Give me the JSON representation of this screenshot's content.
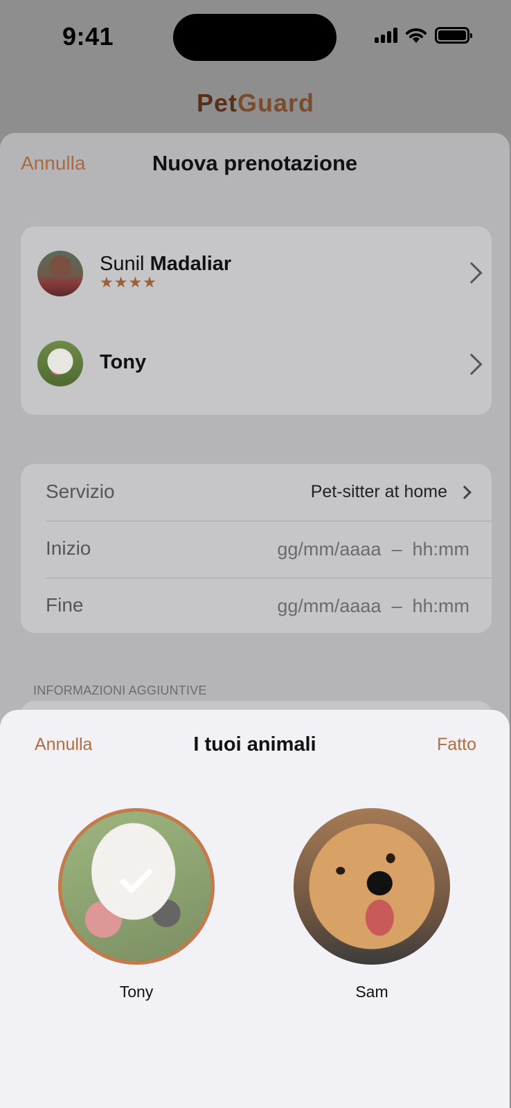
{
  "status_bar": {
    "time": "9:41"
  },
  "brand": {
    "part1": "Pet",
    "part2": "Guard"
  },
  "booking_sheet": {
    "cancel_label": "Annulla",
    "title": "Nuova prenotazione",
    "sitter": {
      "first_name": "Sunil",
      "last_name": "Madaliar",
      "stars": "★★★★",
      "rating": 4
    },
    "pet": {
      "name": "Tony"
    },
    "service": {
      "label": "Servizio",
      "value": "Pet-sitter at home"
    },
    "start": {
      "label": "Inizio",
      "placeholder": "gg/mm/aaaa  –  hh:mm"
    },
    "end": {
      "label": "Fine",
      "placeholder": "gg/mm/aaaa  –  hh:mm"
    },
    "additional_info_header": "INFORMAZIONI AGGIUNTIVE"
  },
  "pets_modal": {
    "cancel_label": "Annulla",
    "title": "I tuoi animali",
    "done_label": "Fatto",
    "pets": [
      {
        "name": "Tony",
        "selected": true
      },
      {
        "name": "Sam",
        "selected": false
      }
    ]
  },
  "colors": {
    "accent": "#b06d40",
    "brand_dark": "#5a2f18",
    "brand_light": "#7a4b2c",
    "selected_ring": "#c47a4a"
  }
}
